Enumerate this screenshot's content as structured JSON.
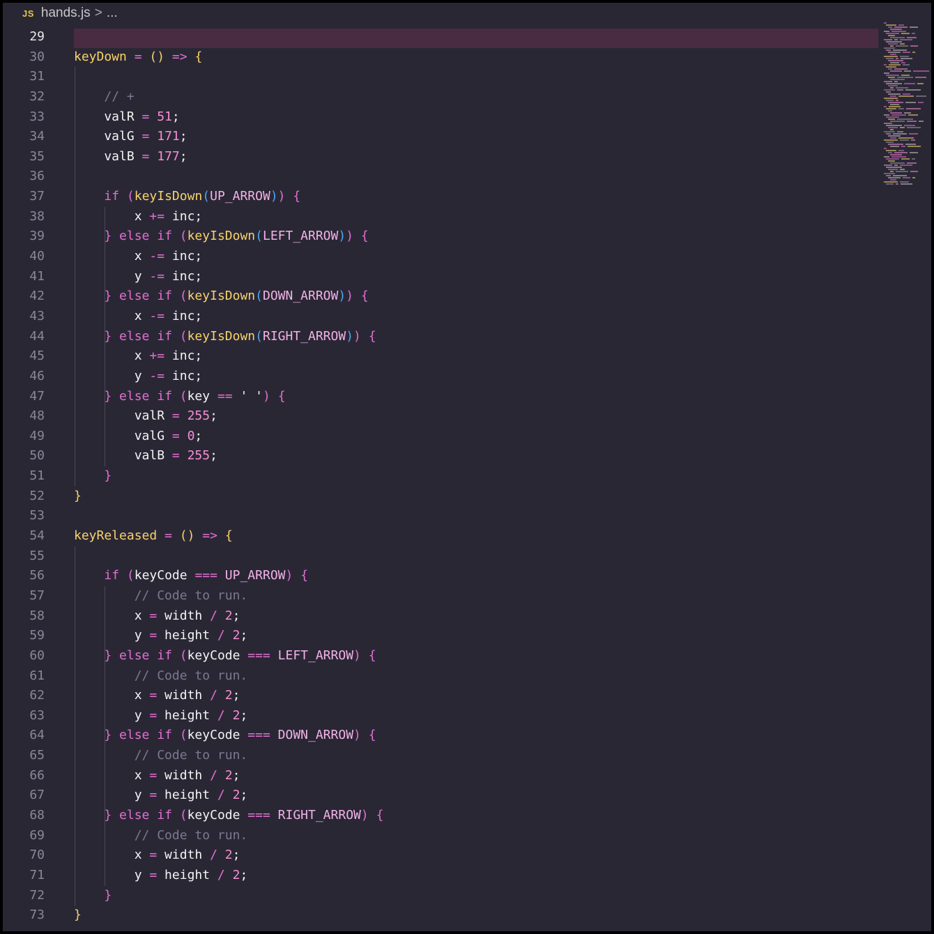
{
  "tab": {
    "icon": "js-file-icon",
    "icon_text": "JS",
    "filename": "hands.js",
    "breadcrumb_sep": ">",
    "breadcrumb_more": "..."
  },
  "editor": {
    "current_line": 29,
    "colors": {
      "background": "#2a2735",
      "line_highlight": "#4a2c42",
      "keyword": "#e26fd2",
      "function": "#f7d36b",
      "number": "#f58fd4",
      "comment": "#7b7890",
      "bracket_blue": "#4ea6f0"
    },
    "lines": [
      {
        "n": "29",
        "tokens": []
      },
      {
        "n": "30",
        "tokens": [
          [
            "fn",
            "keyDown"
          ],
          [
            "plain",
            " "
          ],
          [
            "op",
            "="
          ],
          [
            "plain",
            " "
          ],
          [
            "p1",
            "()"
          ],
          [
            "plain",
            " "
          ],
          [
            "op",
            "=>"
          ],
          [
            "plain",
            " "
          ],
          [
            "p1",
            "{"
          ]
        ]
      },
      {
        "n": "31",
        "tokens": []
      },
      {
        "n": "32",
        "tokens": [
          [
            "plain",
            "    "
          ],
          [
            "cm",
            "// +"
          ]
        ]
      },
      {
        "n": "33",
        "tokens": [
          [
            "plain",
            "    valR "
          ],
          [
            "op",
            "="
          ],
          [
            "plain",
            " "
          ],
          [
            "num",
            "51"
          ],
          [
            "plain",
            ";"
          ]
        ]
      },
      {
        "n": "34",
        "tokens": [
          [
            "plain",
            "    valG "
          ],
          [
            "op",
            "="
          ],
          [
            "plain",
            " "
          ],
          [
            "num",
            "171"
          ],
          [
            "plain",
            ";"
          ]
        ]
      },
      {
        "n": "35",
        "tokens": [
          [
            "plain",
            "    valB "
          ],
          [
            "op",
            "="
          ],
          [
            "plain",
            " "
          ],
          [
            "num",
            "177"
          ],
          [
            "plain",
            ";"
          ]
        ]
      },
      {
        "n": "36",
        "tokens": []
      },
      {
        "n": "37",
        "tokens": [
          [
            "plain",
            "    "
          ],
          [
            "kw",
            "if"
          ],
          [
            "plain",
            " "
          ],
          [
            "p2",
            "("
          ],
          [
            "fn",
            "keyIsDown"
          ],
          [
            "p3",
            "("
          ],
          [
            "con",
            "UP_ARROW"
          ],
          [
            "p3",
            ")"
          ],
          [
            "p2",
            ")"
          ],
          [
            "plain",
            " "
          ],
          [
            "p2",
            "{"
          ]
        ]
      },
      {
        "n": "38",
        "tokens": [
          [
            "plain",
            "        x "
          ],
          [
            "op",
            "+="
          ],
          [
            "plain",
            " inc;"
          ]
        ]
      },
      {
        "n": "39",
        "tokens": [
          [
            "plain",
            "    "
          ],
          [
            "p2",
            "}"
          ],
          [
            "plain",
            " "
          ],
          [
            "kw",
            "else if"
          ],
          [
            "plain",
            " "
          ],
          [
            "p2",
            "("
          ],
          [
            "fn",
            "keyIsDown"
          ],
          [
            "p3",
            "("
          ],
          [
            "con",
            "LEFT_ARROW"
          ],
          [
            "p3",
            ")"
          ],
          [
            "p2",
            ")"
          ],
          [
            "plain",
            " "
          ],
          [
            "p2",
            "{"
          ]
        ]
      },
      {
        "n": "40",
        "tokens": [
          [
            "plain",
            "        x "
          ],
          [
            "op",
            "-="
          ],
          [
            "plain",
            " inc;"
          ]
        ]
      },
      {
        "n": "41",
        "tokens": [
          [
            "plain",
            "        y "
          ],
          [
            "op",
            "-="
          ],
          [
            "plain",
            " inc;"
          ]
        ]
      },
      {
        "n": "42",
        "tokens": [
          [
            "plain",
            "    "
          ],
          [
            "p2",
            "}"
          ],
          [
            "plain",
            " "
          ],
          [
            "kw",
            "else if"
          ],
          [
            "plain",
            " "
          ],
          [
            "p2",
            "("
          ],
          [
            "fn",
            "keyIsDown"
          ],
          [
            "p3",
            "("
          ],
          [
            "con",
            "DOWN_ARROW"
          ],
          [
            "p3",
            ")"
          ],
          [
            "p2",
            ")"
          ],
          [
            "plain",
            " "
          ],
          [
            "p2",
            "{"
          ]
        ]
      },
      {
        "n": "43",
        "tokens": [
          [
            "plain",
            "        x "
          ],
          [
            "op",
            "-="
          ],
          [
            "plain",
            " inc;"
          ]
        ]
      },
      {
        "n": "44",
        "tokens": [
          [
            "plain",
            "    "
          ],
          [
            "p2",
            "}"
          ],
          [
            "plain",
            " "
          ],
          [
            "kw",
            "else if"
          ],
          [
            "plain",
            " "
          ],
          [
            "p2",
            "("
          ],
          [
            "fn",
            "keyIsDown"
          ],
          [
            "p3",
            "("
          ],
          [
            "con",
            "RIGHT_ARROW"
          ],
          [
            "p3",
            ")"
          ],
          [
            "p2",
            ")"
          ],
          [
            "plain",
            " "
          ],
          [
            "p2",
            "{"
          ]
        ]
      },
      {
        "n": "45",
        "tokens": [
          [
            "plain",
            "        x "
          ],
          [
            "op",
            "+="
          ],
          [
            "plain",
            " inc;"
          ]
        ]
      },
      {
        "n": "46",
        "tokens": [
          [
            "plain",
            "        y "
          ],
          [
            "op",
            "-="
          ],
          [
            "plain",
            " inc;"
          ]
        ]
      },
      {
        "n": "47",
        "tokens": [
          [
            "plain",
            "    "
          ],
          [
            "p2",
            "}"
          ],
          [
            "plain",
            " "
          ],
          [
            "kw",
            "else if"
          ],
          [
            "plain",
            " "
          ],
          [
            "p2",
            "("
          ],
          [
            "plain",
            "key "
          ],
          [
            "op",
            "=="
          ],
          [
            "plain",
            " "
          ],
          [
            "str",
            "' '"
          ],
          [
            "p2",
            ")"
          ],
          [
            "plain",
            " "
          ],
          [
            "p2",
            "{"
          ]
        ]
      },
      {
        "n": "48",
        "tokens": [
          [
            "plain",
            "        valR "
          ],
          [
            "op",
            "="
          ],
          [
            "plain",
            " "
          ],
          [
            "num",
            "255"
          ],
          [
            "plain",
            ";"
          ]
        ]
      },
      {
        "n": "49",
        "tokens": [
          [
            "plain",
            "        valG "
          ],
          [
            "op",
            "="
          ],
          [
            "plain",
            " "
          ],
          [
            "num",
            "0"
          ],
          [
            "plain",
            ";"
          ]
        ]
      },
      {
        "n": "50",
        "tokens": [
          [
            "plain",
            "        valB "
          ],
          [
            "op",
            "="
          ],
          [
            "plain",
            " "
          ],
          [
            "num",
            "255"
          ],
          [
            "plain",
            ";"
          ]
        ]
      },
      {
        "n": "51",
        "tokens": [
          [
            "plain",
            "    "
          ],
          [
            "p2",
            "}"
          ]
        ]
      },
      {
        "n": "52",
        "tokens": [
          [
            "p1",
            "}"
          ]
        ]
      },
      {
        "n": "53",
        "tokens": []
      },
      {
        "n": "54",
        "tokens": [
          [
            "fn",
            "keyReleased"
          ],
          [
            "plain",
            " "
          ],
          [
            "op",
            "="
          ],
          [
            "plain",
            " "
          ],
          [
            "p1",
            "()"
          ],
          [
            "plain",
            " "
          ],
          [
            "op",
            "=>"
          ],
          [
            "plain",
            " "
          ],
          [
            "p1",
            "{"
          ]
        ]
      },
      {
        "n": "55",
        "tokens": []
      },
      {
        "n": "56",
        "tokens": [
          [
            "plain",
            "    "
          ],
          [
            "kw",
            "if"
          ],
          [
            "plain",
            " "
          ],
          [
            "p2",
            "("
          ],
          [
            "plain",
            "keyCode "
          ],
          [
            "op",
            "==="
          ],
          [
            "plain",
            " "
          ],
          [
            "con",
            "UP_ARROW"
          ],
          [
            "p2",
            ")"
          ],
          [
            "plain",
            " "
          ],
          [
            "p2",
            "{"
          ]
        ]
      },
      {
        "n": "57",
        "tokens": [
          [
            "plain",
            "        "
          ],
          [
            "cm",
            "// Code to run."
          ]
        ]
      },
      {
        "n": "58",
        "tokens": [
          [
            "plain",
            "        x "
          ],
          [
            "op",
            "="
          ],
          [
            "plain",
            " width "
          ],
          [
            "op",
            "/"
          ],
          [
            "plain",
            " "
          ],
          [
            "num",
            "2"
          ],
          [
            "plain",
            ";"
          ]
        ]
      },
      {
        "n": "59",
        "tokens": [
          [
            "plain",
            "        y "
          ],
          [
            "op",
            "="
          ],
          [
            "plain",
            " height "
          ],
          [
            "op",
            "/"
          ],
          [
            "plain",
            " "
          ],
          [
            "num",
            "2"
          ],
          [
            "plain",
            ";"
          ]
        ]
      },
      {
        "n": "60",
        "tokens": [
          [
            "plain",
            "    "
          ],
          [
            "p2",
            "}"
          ],
          [
            "plain",
            " "
          ],
          [
            "kw",
            "else if"
          ],
          [
            "plain",
            " "
          ],
          [
            "p2",
            "("
          ],
          [
            "plain",
            "keyCode "
          ],
          [
            "op",
            "==="
          ],
          [
            "plain",
            " "
          ],
          [
            "con",
            "LEFT_ARROW"
          ],
          [
            "p2",
            ")"
          ],
          [
            "plain",
            " "
          ],
          [
            "p2",
            "{"
          ]
        ]
      },
      {
        "n": "61",
        "tokens": [
          [
            "plain",
            "        "
          ],
          [
            "cm",
            "// Code to run."
          ]
        ]
      },
      {
        "n": "62",
        "tokens": [
          [
            "plain",
            "        x "
          ],
          [
            "op",
            "="
          ],
          [
            "plain",
            " width "
          ],
          [
            "op",
            "/"
          ],
          [
            "plain",
            " "
          ],
          [
            "num",
            "2"
          ],
          [
            "plain",
            ";"
          ]
        ]
      },
      {
        "n": "63",
        "tokens": [
          [
            "plain",
            "        y "
          ],
          [
            "op",
            "="
          ],
          [
            "plain",
            " height "
          ],
          [
            "op",
            "/"
          ],
          [
            "plain",
            " "
          ],
          [
            "num",
            "2"
          ],
          [
            "plain",
            ";"
          ]
        ]
      },
      {
        "n": "64",
        "tokens": [
          [
            "plain",
            "    "
          ],
          [
            "p2",
            "}"
          ],
          [
            "plain",
            " "
          ],
          [
            "kw",
            "else if"
          ],
          [
            "plain",
            " "
          ],
          [
            "p2",
            "("
          ],
          [
            "plain",
            "keyCode "
          ],
          [
            "op",
            "==="
          ],
          [
            "plain",
            " "
          ],
          [
            "con",
            "DOWN_ARROW"
          ],
          [
            "p2",
            ")"
          ],
          [
            "plain",
            " "
          ],
          [
            "p2",
            "{"
          ]
        ]
      },
      {
        "n": "65",
        "tokens": [
          [
            "plain",
            "        "
          ],
          [
            "cm",
            "// Code to run."
          ]
        ]
      },
      {
        "n": "66",
        "tokens": [
          [
            "plain",
            "        x "
          ],
          [
            "op",
            "="
          ],
          [
            "plain",
            " width "
          ],
          [
            "op",
            "/"
          ],
          [
            "plain",
            " "
          ],
          [
            "num",
            "2"
          ],
          [
            "plain",
            ";"
          ]
        ]
      },
      {
        "n": "67",
        "tokens": [
          [
            "plain",
            "        y "
          ],
          [
            "op",
            "="
          ],
          [
            "plain",
            " height "
          ],
          [
            "op",
            "/"
          ],
          [
            "plain",
            " "
          ],
          [
            "num",
            "2"
          ],
          [
            "plain",
            ";"
          ]
        ]
      },
      {
        "n": "68",
        "tokens": [
          [
            "plain",
            "    "
          ],
          [
            "p2",
            "}"
          ],
          [
            "plain",
            " "
          ],
          [
            "kw",
            "else if"
          ],
          [
            "plain",
            " "
          ],
          [
            "p2",
            "("
          ],
          [
            "plain",
            "keyCode "
          ],
          [
            "op",
            "==="
          ],
          [
            "plain",
            " "
          ],
          [
            "con",
            "RIGHT_ARROW"
          ],
          [
            "p2",
            ")"
          ],
          [
            "plain",
            " "
          ],
          [
            "p2",
            "{"
          ]
        ]
      },
      {
        "n": "69",
        "tokens": [
          [
            "plain",
            "        "
          ],
          [
            "cm",
            "// Code to run."
          ]
        ]
      },
      {
        "n": "70",
        "tokens": [
          [
            "plain",
            "        x "
          ],
          [
            "op",
            "="
          ],
          [
            "plain",
            " width "
          ],
          [
            "op",
            "/"
          ],
          [
            "plain",
            " "
          ],
          [
            "num",
            "2"
          ],
          [
            "plain",
            ";"
          ]
        ]
      },
      {
        "n": "71",
        "tokens": [
          [
            "plain",
            "        y "
          ],
          [
            "op",
            "="
          ],
          [
            "plain",
            " height "
          ],
          [
            "op",
            "/"
          ],
          [
            "plain",
            " "
          ],
          [
            "num",
            "2"
          ],
          [
            "plain",
            ";"
          ]
        ]
      },
      {
        "n": "72",
        "tokens": [
          [
            "plain",
            "    "
          ],
          [
            "p2",
            "}"
          ]
        ]
      },
      {
        "n": "73",
        "tokens": [
          [
            "p1",
            "}"
          ]
        ]
      }
    ]
  }
}
